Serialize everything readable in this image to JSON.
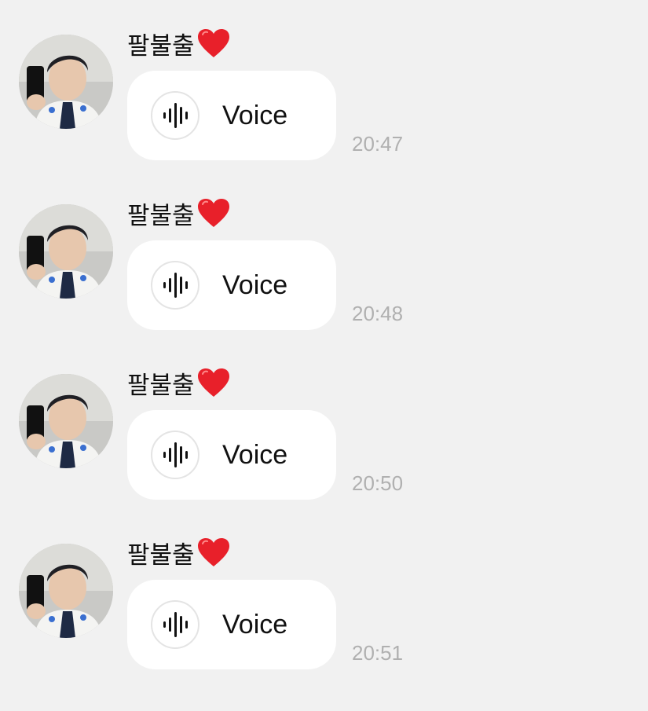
{
  "chat": {
    "messages": [
      {
        "sender": "팔불출",
        "sender_emoji": "heart-icon",
        "type_label": "Voice",
        "time": "20:47"
      },
      {
        "sender": "팔불출",
        "sender_emoji": "heart-icon",
        "type_label": "Voice",
        "time": "20:48"
      },
      {
        "sender": "팔불출",
        "sender_emoji": "heart-icon",
        "type_label": "Voice",
        "time": "20:50"
      },
      {
        "sender": "팔불출",
        "sender_emoji": "heart-icon",
        "type_label": "Voice",
        "time": "20:51"
      }
    ]
  },
  "colors": {
    "background": "#f1f1f1",
    "bubble": "#ffffff",
    "timestamp": "#b0b0b0",
    "heart": "#e8202a"
  }
}
